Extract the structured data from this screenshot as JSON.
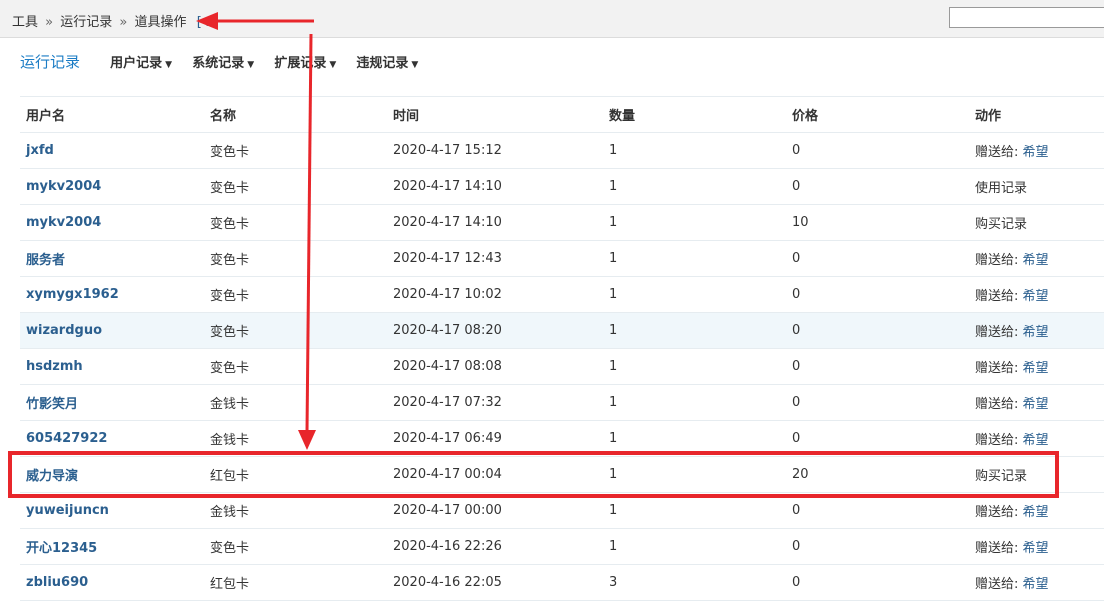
{
  "breadcrumb": {
    "items": [
      "工具",
      "运行记录",
      "道具操作"
    ],
    "separator": "»",
    "expand": "[+]"
  },
  "subnav": {
    "title": "运行记录",
    "menus": [
      "用户记录",
      "系统记录",
      "扩展记录",
      "违规记录"
    ],
    "caret": "▼"
  },
  "table": {
    "headers": [
      "用户名",
      "名称",
      "时间",
      "数量",
      "价格",
      "动作"
    ],
    "rows": [
      {
        "user": "jxfd",
        "name": "变色卡",
        "time": "2020-4-17 15:12",
        "qty": "1",
        "price": "0",
        "action": "赠送给:",
        "target": "希望"
      },
      {
        "user": "mykv2004",
        "name": "变色卡",
        "time": "2020-4-17 14:10",
        "qty": "1",
        "price": "0",
        "action": "使用记录",
        "target": ""
      },
      {
        "user": "mykv2004",
        "name": "变色卡",
        "time": "2020-4-17 14:10",
        "qty": "1",
        "price": "10",
        "action": "购买记录",
        "target": ""
      },
      {
        "user": "服务者",
        "name": "变色卡",
        "time": "2020-4-17 12:43",
        "qty": "1",
        "price": "0",
        "action": "赠送给:",
        "target": "希望"
      },
      {
        "user": "xymygx1962",
        "name": "变色卡",
        "time": "2020-4-17 10:02",
        "qty": "1",
        "price": "0",
        "action": "赠送给:",
        "target": "希望"
      },
      {
        "user": "wizardguo",
        "name": "变色卡",
        "time": "2020-4-17 08:20",
        "qty": "1",
        "price": "0",
        "action": "赠送给:",
        "target": "希望"
      },
      {
        "user": "hsdzmh",
        "name": "变色卡",
        "time": "2020-4-17 08:08",
        "qty": "1",
        "price": "0",
        "action": "赠送给:",
        "target": "希望"
      },
      {
        "user": "竹影笑月",
        "name": "金钱卡",
        "time": "2020-4-17 07:32",
        "qty": "1",
        "price": "0",
        "action": "赠送给:",
        "target": "希望"
      },
      {
        "user": "605427922",
        "name": "金钱卡",
        "time": "2020-4-17 06:49",
        "qty": "1",
        "price": "0",
        "action": "赠送给:",
        "target": "希望"
      },
      {
        "user": "威力导演",
        "name": "红包卡",
        "time": "2020-4-17 00:04",
        "qty": "1",
        "price": "20",
        "action": "购买记录",
        "target": ""
      },
      {
        "user": "yuweijuncn",
        "name": "金钱卡",
        "time": "2020-4-17 00:00",
        "qty": "1",
        "price": "0",
        "action": "赠送给:",
        "target": "希望"
      },
      {
        "user": "开心12345",
        "name": "变色卡",
        "time": "2020-4-16 22:26",
        "qty": "1",
        "price": "0",
        "action": "赠送给:",
        "target": "希望"
      },
      {
        "user": "zbliu690",
        "name": "红包卡",
        "time": "2020-4-16 22:05",
        "qty": "3",
        "price": "0",
        "action": "赠送给:",
        "target": "希望"
      }
    ]
  },
  "colors": {
    "link": "#2b5f8f",
    "accent": "#1b7cc5",
    "annotation": "#e8262b"
  }
}
